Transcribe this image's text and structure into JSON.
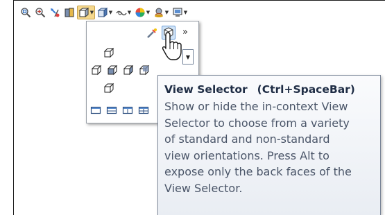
{
  "toolbar": {
    "items": [
      {
        "icon": "zoom-to-fit-icon"
      },
      {
        "icon": "zoom-to-area-icon"
      },
      {
        "icon": "previous-view-icon"
      },
      {
        "icon": "section-view-icon"
      },
      {
        "icon": "view-orientation-icon",
        "active": true
      },
      {
        "icon": "display-style-icon"
      },
      {
        "icon": "hide-show-items-icon"
      },
      {
        "icon": "edit-appearance-icon"
      },
      {
        "icon": "apply-scene-icon"
      },
      {
        "icon": "view-settings-icon"
      }
    ]
  },
  "flyout": {
    "more_symbol": "»",
    "icons": [
      "new-view-icon",
      "view-selector-icon",
      "top-view-icon",
      "left-view-icon",
      "front-view-icon",
      "right-view-icon",
      "back-view-icon",
      "bottom-view-icon",
      "single-view-icon",
      "two-view-horizontal-icon",
      "two-view-vertical-icon",
      "four-view-icon"
    ]
  },
  "tooltip": {
    "title": "View Selector",
    "shortcut": "(Ctrl+SpaceBar)",
    "lines": [
      "Show or hide the in-context View",
      "Selector to choose from a variety",
      "of standard and non-standard",
      "view orientations. Press Alt to",
      "expose only the back faces of the",
      "View Selector."
    ]
  },
  "colors": {
    "active_button": "#f5d88d",
    "tooltip_title": "#1f2d45",
    "tooltip_text": "#4a5568",
    "selection": "#cfe3f7"
  }
}
